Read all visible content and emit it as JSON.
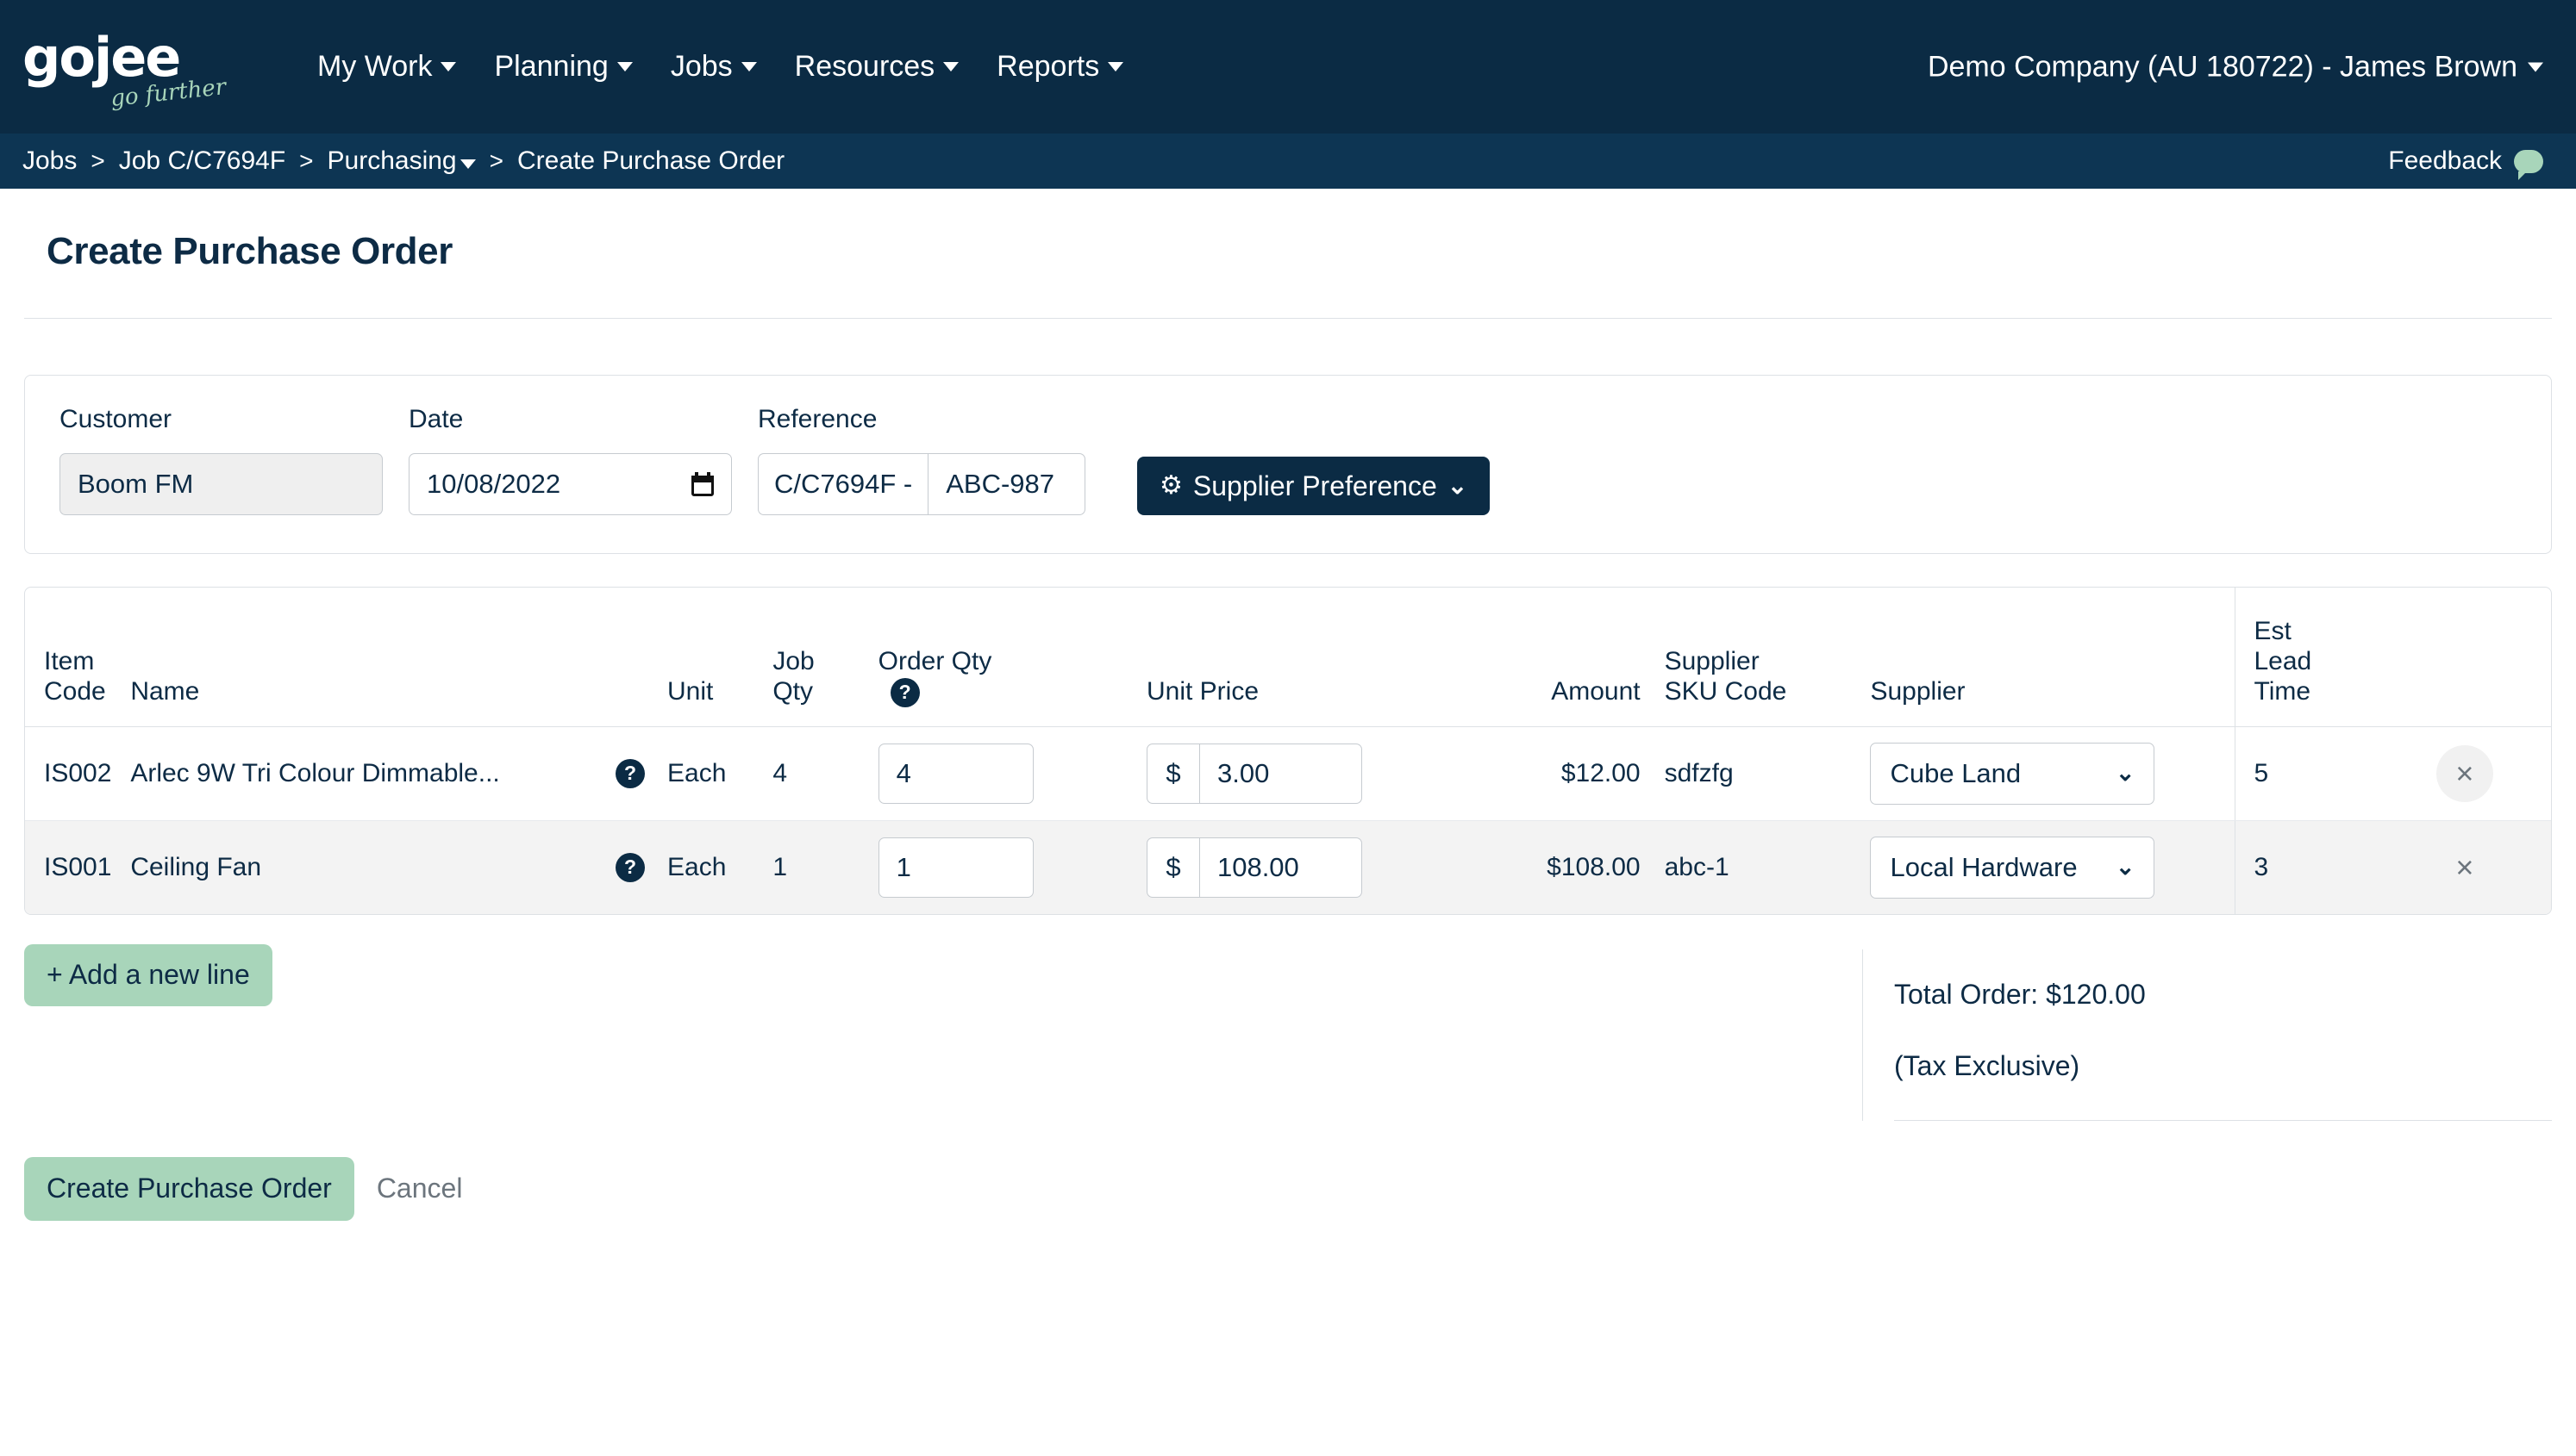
{
  "brand": {
    "logo_text": "gojee",
    "logo_tagline": "go further",
    "navy": "#0b2b44",
    "green": "#a8d5ba"
  },
  "topnav": {
    "items": [
      {
        "label": "My Work"
      },
      {
        "label": "Planning"
      },
      {
        "label": "Jobs"
      },
      {
        "label": "Resources"
      },
      {
        "label": "Reports"
      }
    ],
    "account": "Demo Company (AU 180722) - James Brown"
  },
  "breadcrumb": {
    "items": [
      {
        "label": "Jobs",
        "caret": false
      },
      {
        "label": "Job C/C7694F",
        "caret": false
      },
      {
        "label": "Purchasing",
        "caret": true
      },
      {
        "label": "Create Purchase Order",
        "caret": false
      }
    ],
    "separator": ">",
    "feedback_label": "Feedback"
  },
  "page": {
    "title": "Create Purchase Order"
  },
  "header_form": {
    "customer": {
      "label": "Customer",
      "value": "Boom FM",
      "disabled": true
    },
    "date": {
      "label": "Date",
      "value": "10/08/2022"
    },
    "reference": {
      "label": "Reference",
      "prefix": "C/C7694F -",
      "value": "ABC-987"
    },
    "supplier_preference_button": "Supplier Preference"
  },
  "table": {
    "columns": [
      "Item\nCode",
      "Name",
      "Unit",
      "Job\nQty",
      "Order Qty",
      "Unit Price",
      "Amount",
      "Supplier\nSKU Code",
      "Supplier",
      "Est\nLead\nTime",
      ""
    ],
    "rows": [
      {
        "item_code": "IS002",
        "name": "Arlec 9W Tri Colour Dimmable...",
        "unit": "Each",
        "job_qty": "4",
        "order_qty": "4",
        "currency": "$",
        "unit_price": "3.00",
        "amount": "$12.00",
        "supplier_sku": "sdfzfg",
        "supplier": "Cube Land",
        "lead_time": "5",
        "remove": "×"
      },
      {
        "item_code": "IS001",
        "name": "Ceiling Fan",
        "unit": "Each",
        "job_qty": "1",
        "order_qty": "1",
        "currency": "$",
        "unit_price": "108.00",
        "amount": "$108.00",
        "supplier_sku": "abc-1",
        "supplier": "Local Hardware",
        "lead_time": "3",
        "remove": "×"
      }
    ]
  },
  "actions": {
    "add_line": "+ Add a new line",
    "total_order": "Total Order: $120.00",
    "tax_note": "(Tax Exclusive)",
    "create": "Create Purchase Order",
    "cancel": "Cancel"
  }
}
